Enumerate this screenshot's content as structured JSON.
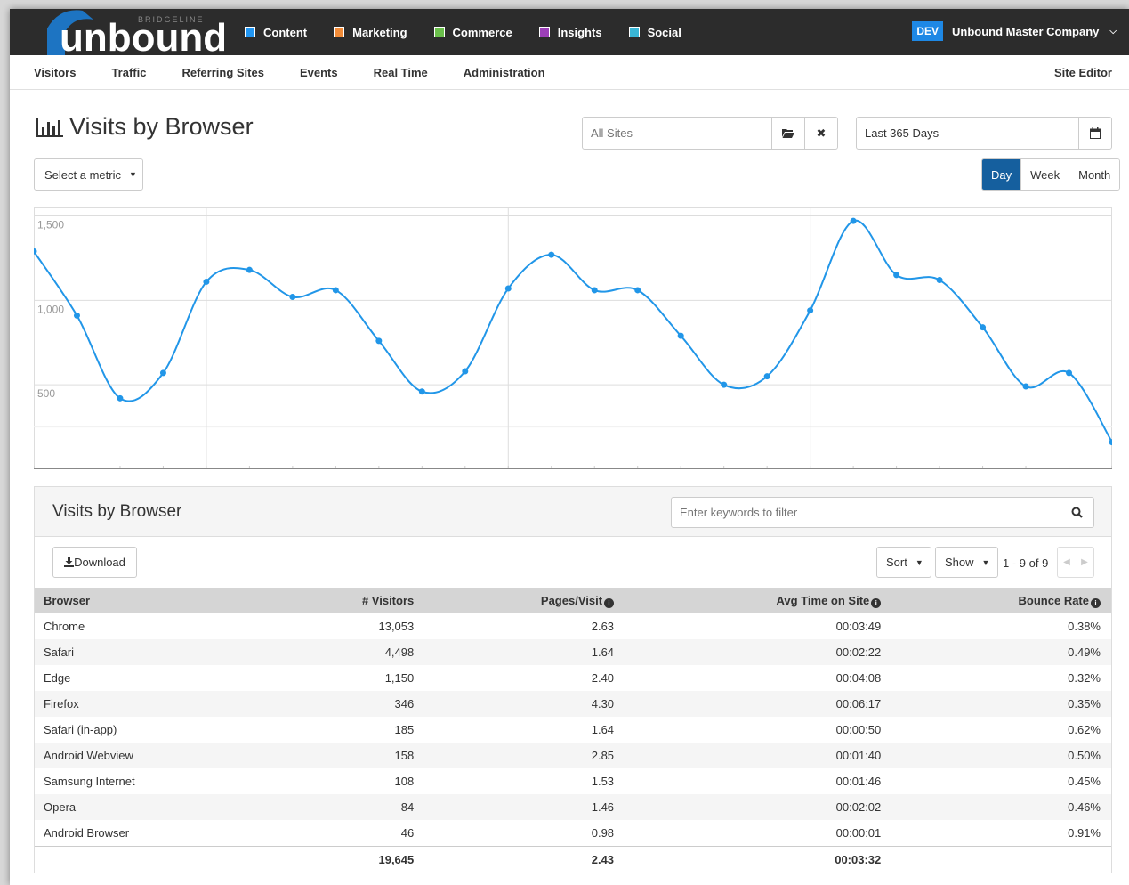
{
  "brand": {
    "name": "unbound",
    "tagline": "BRIDGELINE"
  },
  "modules": [
    {
      "label": "Content",
      "color": "#2196f3"
    },
    {
      "label": "Marketing",
      "color": "#f28c38"
    },
    {
      "label": "Commerce",
      "color": "#6abf4b"
    },
    {
      "label": "Insights",
      "color": "#9c3fb8"
    },
    {
      "label": "Social",
      "color": "#39b6d6"
    }
  ],
  "account": {
    "env": "DEV",
    "company": "Unbound Master Company"
  },
  "nav": {
    "items": [
      "Visitors",
      "Traffic",
      "Referring Sites",
      "Events",
      "Real Time",
      "Administration"
    ],
    "site_editor": "Site Editor"
  },
  "page": {
    "title": "Visits by Browser"
  },
  "filters": {
    "sites_placeholder": "All Sites",
    "date_range": "Last 365 Days",
    "metric_label": "Select a metric",
    "periods": [
      "Day",
      "Week",
      "Month"
    ],
    "active_period": "Day"
  },
  "chart_data": {
    "type": "line",
    "yticks": [
      "1,500",
      "1,000",
      "500"
    ],
    "ylim": [
      0,
      1550
    ],
    "x": [
      0,
      1,
      2,
      3,
      4,
      5,
      6,
      7,
      8,
      9,
      10,
      11,
      12,
      13,
      14,
      15,
      16,
      17,
      18,
      19,
      20,
      21,
      22,
      23,
      24,
      25
    ],
    "values": [
      1290,
      910,
      420,
      570,
      1110,
      1180,
      1020,
      1060,
      760,
      460,
      580,
      1070,
      1270,
      1060,
      1060,
      790,
      500,
      550,
      940,
      1470,
      1150,
      1120,
      840,
      490,
      570,
      160
    ],
    "line_color": "#2196e8",
    "grid": true
  },
  "table": {
    "title": "Visits by Browser",
    "filter_placeholder": "Enter keywords to filter",
    "download_label": "Download",
    "sort_label": "Sort",
    "show_label": "Show",
    "pager": "1 - 9 of 9",
    "columns": [
      "Browser",
      "# Visitors",
      "Pages/Visit",
      "Avg Time on Site",
      "Bounce Rate"
    ],
    "rows": [
      [
        "Chrome",
        "13,053",
        "2.63",
        "00:03:49",
        "0.38%"
      ],
      [
        "Safari",
        "4,498",
        "1.64",
        "00:02:22",
        "0.49%"
      ],
      [
        "Edge",
        "1,150",
        "2.40",
        "00:04:08",
        "0.32%"
      ],
      [
        "Firefox",
        "346",
        "4.30",
        "00:06:17",
        "0.35%"
      ],
      [
        "Safari (in-app)",
        "185",
        "1.64",
        "00:00:50",
        "0.62%"
      ],
      [
        "Android Webview",
        "158",
        "2.85",
        "00:01:40",
        "0.50%"
      ],
      [
        "Samsung Internet",
        "108",
        "1.53",
        "00:01:46",
        "0.45%"
      ],
      [
        "Opera",
        "84",
        "1.46",
        "00:02:02",
        "0.46%"
      ],
      [
        "Android Browser",
        "46",
        "0.98",
        "00:00:01",
        "0.91%"
      ]
    ],
    "totals": [
      "",
      "19,645",
      "2.43",
      "00:03:32",
      ""
    ]
  }
}
